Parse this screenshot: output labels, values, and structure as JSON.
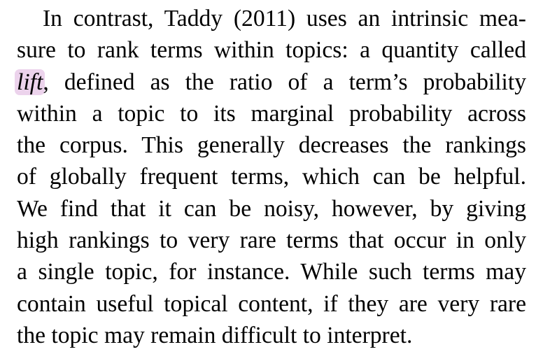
{
  "paragraph": {
    "lines": [
      "In contrast, Taddy (2011) uses an intrinsic mea-",
      "sure to rank terms within topics: a quantity called",
      ", defined as the ratio of a term’s probability",
      "within a topic to its marginal probability across",
      "the corpus. This generally decreases the rankings",
      "of globally frequent terms, which can be helpful.",
      "We find that it can be noisy, however, by giving",
      "high rankings to very rare terms that occur in only",
      "a single topic, for instance. While such terms may",
      "contain useful topical content, if they are very rare",
      "the topic may remain difficult to interpret."
    ],
    "highlighted_term": "lift"
  },
  "colors": {
    "text": "#000000",
    "highlight": "#ecd3ec",
    "background": "#ffffff"
  }
}
